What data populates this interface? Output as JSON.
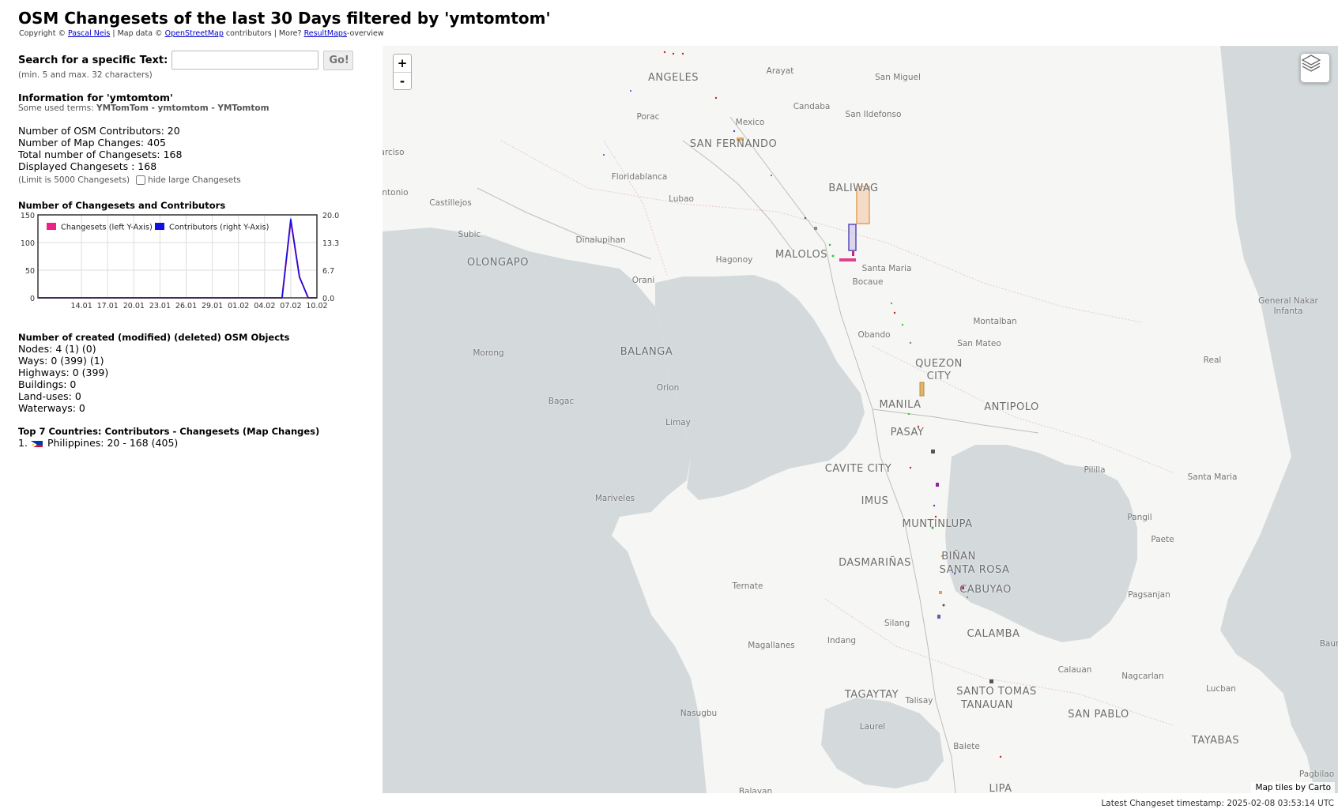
{
  "header": {
    "title": "OSM Changesets of the last 30 Days filtered by 'ymtomtom'",
    "copyright_prefix": "Copyright ©",
    "author_link": "Pascal Neis",
    "map_data_text": "| Map data ©",
    "osm_link": "OpenStreetMap",
    "more_text": "contributors | More?",
    "resultmaps_link": "ResultMaps",
    "overview_suffix": "-overview"
  },
  "search": {
    "label": "Search for a specific Text:",
    "value": "",
    "button_label": "Go!",
    "hint": "(min. 5 and max. 32 characters)"
  },
  "info": {
    "title": "Information for 'ymtomtom'",
    "terms_prefix": "Some used terms:",
    "terms": "YMTomTom - ymtomtom - YMTomtom"
  },
  "stats": {
    "contributors": "Number of OSM Contributors: 20",
    "map_changes": "Number of Map Changes: 405",
    "total_changesets": "Total number of Changesets: 168",
    "displayed_changesets": "Displayed Changesets : 168",
    "limit_text": "(Limit is 5000 Changesets)",
    "hide_large_label": "hide large Changesets",
    "hide_large_checked": false
  },
  "chart_section": {
    "title": "Number of Changesets and Contributors"
  },
  "chart_data": {
    "type": "line",
    "x": [
      "09.01",
      "10.01",
      "11.01",
      "12.01",
      "13.01",
      "14.01",
      "15.01",
      "16.01",
      "17.01",
      "18.01",
      "19.01",
      "20.01",
      "21.01",
      "22.01",
      "23.01",
      "24.01",
      "25.01",
      "26.01",
      "27.01",
      "28.01",
      "29.01",
      "30.01",
      "31.01",
      "01.02",
      "02.02",
      "03.02",
      "04.02",
      "05.02",
      "06.02",
      "07.02",
      "08.02",
      "09.02",
      "10.02"
    ],
    "tick_labels": [
      "14.01",
      "17.01",
      "20.01",
      "23.01",
      "26.01",
      "29.01",
      "01.02",
      "04.02",
      "07.02",
      "10.02"
    ],
    "series": [
      {
        "name": "Changesets (left Y-Axis)",
        "axis": "left",
        "color": "#ee1f8a",
        "values": [
          0,
          0,
          0,
          0,
          0,
          0,
          0,
          0,
          0,
          0,
          0,
          0,
          0,
          0,
          0,
          0,
          0,
          0,
          0,
          0,
          0,
          0,
          0,
          0,
          0,
          0,
          0,
          0,
          0,
          140,
          38,
          0,
          0
        ]
      },
      {
        "name": "Contributors (right Y-Axis)",
        "axis": "right",
        "color": "#1010e0",
        "values": [
          0,
          0,
          0,
          0,
          0,
          0,
          0,
          0,
          0,
          0,
          0,
          0,
          0,
          0,
          0,
          0,
          0,
          0,
          0,
          0,
          0,
          0,
          0,
          0,
          0,
          0,
          0,
          0,
          0,
          19,
          5,
          0,
          0
        ]
      }
    ],
    "left_axis": {
      "ylim": [
        0,
        150
      ],
      "ticks": [
        "0",
        "50",
        "100",
        "150"
      ]
    },
    "right_axis": {
      "ylim": [
        0,
        20
      ],
      "ticks": [
        "0.0",
        "6.7",
        "13.3",
        "20.0"
      ]
    },
    "legend_position": "top-left",
    "grid": true
  },
  "objects": {
    "title": "Number of created (modified) (deleted) OSM Objects",
    "nodes": "Nodes: 4 (1) (0)",
    "ways": "Ways: 0 (399) (1)",
    "highways": "Highways: 0 (399)",
    "buildings": "Buildings: 0",
    "landuses": "Land-uses: 0",
    "waterways": "Waterways: 0"
  },
  "countries": {
    "title": "Top 7 Countries: Contributors - Changesets (Map Changes)",
    "rows": [
      {
        "rank": "1.",
        "text": "Philippines: 20 - 168 (405)"
      }
    ]
  },
  "map": {
    "zoom_in": "+",
    "zoom_out": "-",
    "layers_icon": "layers-icon",
    "attribution": "Map tiles by Carto",
    "labels": [
      {
        "text": "ANGELES",
        "big": true
      },
      {
        "text": "Arayat"
      },
      {
        "text": "San Miguel"
      },
      {
        "text": "Porac"
      },
      {
        "text": "Mexico"
      },
      {
        "text": "Candaba"
      },
      {
        "text": "San Ildefonso"
      },
      {
        "text": "SAN FERNANDO",
        "big": true
      },
      {
        "text": "arciso"
      },
      {
        "text": "Floridablanca"
      },
      {
        "text": "Lubao"
      },
      {
        "text": "BALIWAG",
        "big": true
      },
      {
        "text": "ntonio"
      },
      {
        "text": "Castillejos"
      },
      {
        "text": "Subic"
      },
      {
        "text": "Dinalupihan"
      },
      {
        "text": "OLONGAPO",
        "big": true
      },
      {
        "text": "Hagonoy"
      },
      {
        "text": "MALOLOS",
        "big": true
      },
      {
        "text": "Santa Maria"
      },
      {
        "text": "Orani"
      },
      {
        "text": "Bocaue"
      },
      {
        "text": "General Nakar Infanta"
      },
      {
        "text": "Montalban"
      },
      {
        "text": "Obando"
      },
      {
        "text": "Morong"
      },
      {
        "text": "BALANGA",
        "big": true
      },
      {
        "text": "San Mateo"
      },
      {
        "text": "QUEZON CITY",
        "big": true
      },
      {
        "text": "Real"
      },
      {
        "text": "Orion"
      },
      {
        "text": "MANILA",
        "big": true
      },
      {
        "text": "ANTIPOLO",
        "big": true
      },
      {
        "text": "Bagac"
      },
      {
        "text": "Limay"
      },
      {
        "text": "PASAY",
        "big": true
      },
      {
        "text": "CAVITE CITY",
        "big": true
      },
      {
        "text": "Pililla"
      },
      {
        "text": "Santa Maria"
      },
      {
        "text": "IMUS",
        "big": true
      },
      {
        "text": "Mariveles"
      },
      {
        "text": "MUNTINLUPA",
        "big": true
      },
      {
        "text": "Pangil"
      },
      {
        "text": "Paete"
      },
      {
        "text": "BIÑAN",
        "big": true
      },
      {
        "text": "DASMARIÑAS",
        "big": true
      },
      {
        "text": "SANTA ROSA",
        "big": true
      },
      {
        "text": "Ternate"
      },
      {
        "text": "CABUYAO",
        "big": true
      },
      {
        "text": "Pagsanjan"
      },
      {
        "text": "Silang"
      },
      {
        "text": "CALAMBA",
        "big": true
      },
      {
        "text": "Magallanes"
      },
      {
        "text": "Indang"
      },
      {
        "text": "Baur"
      },
      {
        "text": "Calauan"
      },
      {
        "text": "Nagcarlan"
      },
      {
        "text": "SANTO TOMAS",
        "big": true
      },
      {
        "text": "Lucban"
      },
      {
        "text": "TAGAYTAY",
        "big": true
      },
      {
        "text": "Talisay"
      },
      {
        "text": "TANAUAN",
        "big": true
      },
      {
        "text": "SAN PABLO",
        "big": true
      },
      {
        "text": "Nasugbu"
      },
      {
        "text": "Laurel"
      },
      {
        "text": "TAYABAS",
        "big": true
      },
      {
        "text": "Balete"
      },
      {
        "text": "Pagbilao"
      },
      {
        "text": "LIPA",
        "big": true
      },
      {
        "text": "Balayan"
      }
    ]
  },
  "footer": {
    "timestamp": "Latest Changeset timestamp: 2025-02-08 03:53:14 UTC"
  }
}
